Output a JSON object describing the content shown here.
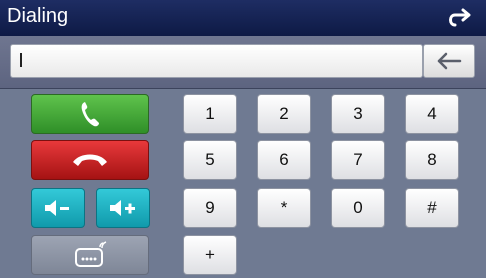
{
  "header": {
    "title": "Dialing",
    "back_icon": "return-arrow-icon"
  },
  "input": {
    "value": "",
    "backspace_icon": "left-arrow-icon"
  },
  "actions": {
    "call_icon": "phone-handset-icon",
    "hangup_icon": "hang-up-icon",
    "volume_down_icon": "volume-down-icon",
    "volume_up_icon": "volume-up-icon",
    "bluetooth_device_icon": "bluetooth-phone-icon",
    "colors": {
      "call": "#3da833",
      "hangup": "#d02222",
      "volume": "#21b4c4",
      "title_bar": "#15224f"
    }
  },
  "keys": [
    "1",
    "2",
    "3",
    "4",
    "5",
    "6",
    "7",
    "8",
    "9",
    "*",
    "0",
    "#",
    "+"
  ]
}
